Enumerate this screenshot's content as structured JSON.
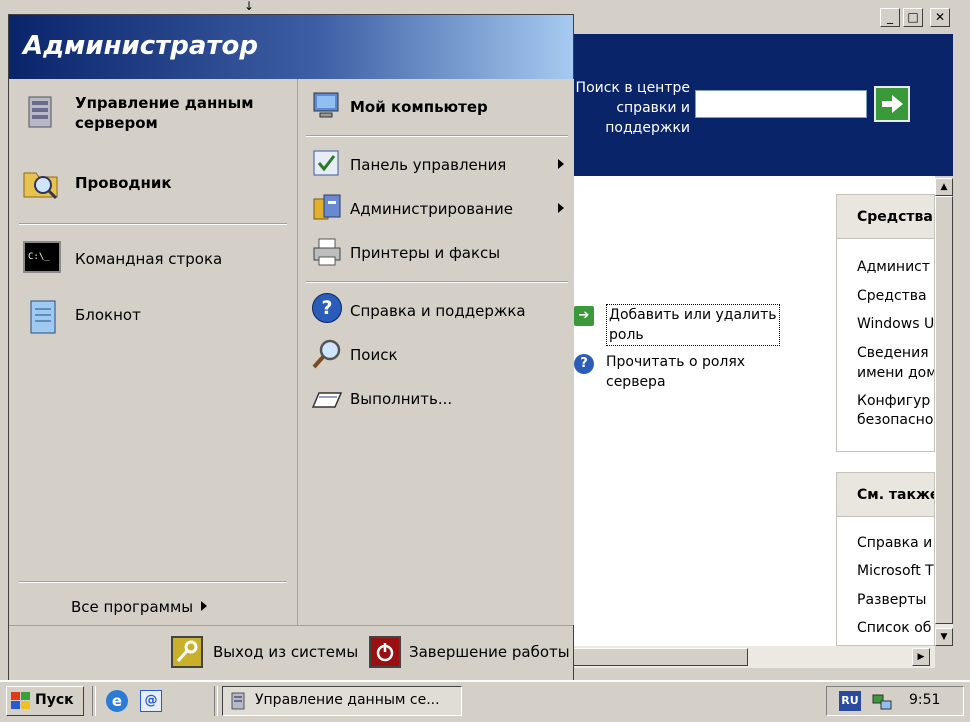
{
  "background_window": {
    "search_label_lines": [
      "Поиск в центре",
      "справки и",
      "поддержки"
    ],
    "tasks": [
      {
        "lines": [
          "Добавить или удалить",
          "роль"
        ],
        "icon": "green-arrow-icon"
      },
      {
        "lines": [
          "Прочитать о ролях",
          "сервера"
        ],
        "icon": "help-icon"
      }
    ],
    "panel_tools": {
      "title": "Средства",
      "items": [
        "Админист",
        "Средства",
        "Windows U",
        "Сведения",
        "имени дом",
        "Конфигур",
        "безопасно"
      ]
    },
    "panel_see_also": {
      "title": "См. также",
      "items": [
        "Справка и",
        "Microsoft T",
        "Разверты",
        "Список об"
      ]
    }
  },
  "start_menu": {
    "user_name": "Администратор",
    "left_items": [
      {
        "label_lines": [
          "Управление данным",
          "сервером"
        ],
        "bold": true,
        "icon": "server-icon"
      },
      {
        "label_lines": [
          "Проводник"
        ],
        "bold": true,
        "icon": "explorer-icon"
      },
      {
        "label_lines": [
          "Командная строка"
        ],
        "bold": false,
        "icon": "cmd-icon"
      },
      {
        "label_lines": [
          "Блокнот"
        ],
        "bold": false,
        "icon": "notepad-icon"
      }
    ],
    "cmd_icon_text": "C:\\_",
    "all_programs": "Все программы",
    "right_items": [
      {
        "label": "Мой компьютер",
        "bold": true,
        "icon": "computer-icon",
        "submenu": false
      },
      {
        "label": "Панель управления",
        "bold": false,
        "icon": "control-panel-icon",
        "submenu": true
      },
      {
        "label": "Администрирование",
        "bold": false,
        "icon": "admin-tools-icon",
        "submenu": true
      },
      {
        "label": "Принтеры и факсы",
        "bold": false,
        "icon": "printer-icon",
        "submenu": false
      },
      {
        "label": "Справка и поддержка",
        "bold": false,
        "icon": "help-icon",
        "submenu": false
      },
      {
        "label": "Поиск",
        "bold": false,
        "icon": "search-icon",
        "submenu": false
      },
      {
        "label": "Выполнить...",
        "bold": false,
        "icon": "run-icon",
        "submenu": false
      }
    ],
    "logoff": "Выход из системы",
    "shutdown": "Завершение работы"
  },
  "taskbar": {
    "start": "Пуск",
    "task_button": "Управление данным се...",
    "language": "RU",
    "clock": "9:51"
  }
}
